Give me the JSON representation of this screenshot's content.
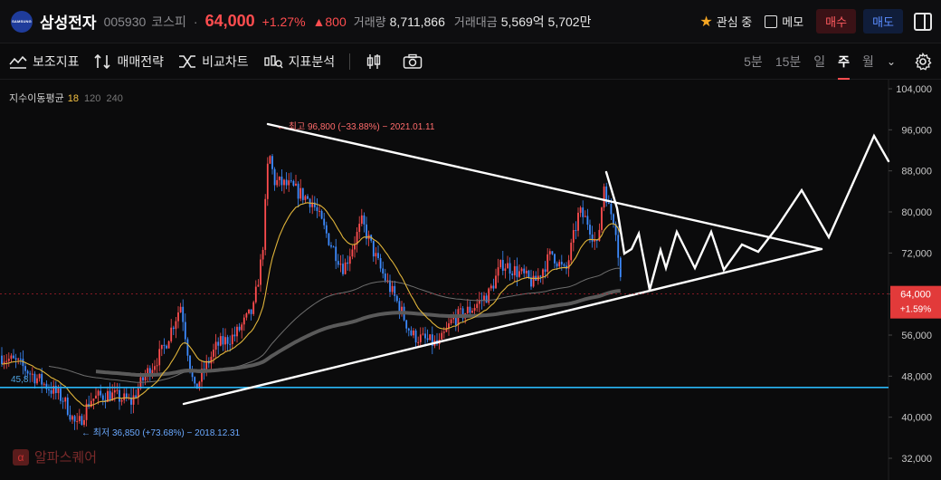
{
  "header": {
    "logo_text": "SAMSUNG",
    "name": "삼성전자",
    "code": "005930",
    "market": "코스피",
    "dot": "·",
    "price": "64,000",
    "change_pct": "+1.27%",
    "change_abs": "▲800",
    "volume_label": "거래량",
    "volume": "8,711,866",
    "amount_label": "거래대금",
    "amount": "5,569억 5,702만",
    "fav_label": "관심 중",
    "memo_label": "메모",
    "buy_label": "매수",
    "sell_label": "매도"
  },
  "toolbar": {
    "tools": [
      "보조지표",
      "매매전략",
      "비교차트",
      "지표분석"
    ],
    "timeframes": [
      "5분",
      "15분",
      "일",
      "주",
      "월"
    ],
    "active_timeframe": "주"
  },
  "legend": {
    "title": "지수이동평균",
    "ma18": "18",
    "ma120": "120",
    "ma240": "240"
  },
  "chart_data": {
    "type": "candlestick",
    "y_axis_ticks": [
      "104,000",
      "96,000",
      "88,000",
      "80,000",
      "72,000",
      "64,000",
      "56,000",
      "48,000",
      "40,000",
      "32,000"
    ],
    "ylim": [
      31000,
      105000
    ],
    "last_price_tag": "64,000",
    "last_change_tag": "+1.59%",
    "hline_label": "45,8",
    "hline_value": 45800,
    "annotations": {
      "high": "최고 96,800 (−33.88%) − 2021.01.11",
      "low": "최저 36,850 (+73.68%) − 2018.12.31"
    },
    "colors": {
      "up": "#ff4d4f",
      "down": "#3d8bff",
      "ma18": "#e0b43a",
      "ma120": "#6e6e6e",
      "ma240": "#888888",
      "hline": "#29b6f6",
      "price_tag": "#e23a3a"
    }
  },
  "watermark": "알파스퀘어",
  "watermark_icon": "α"
}
